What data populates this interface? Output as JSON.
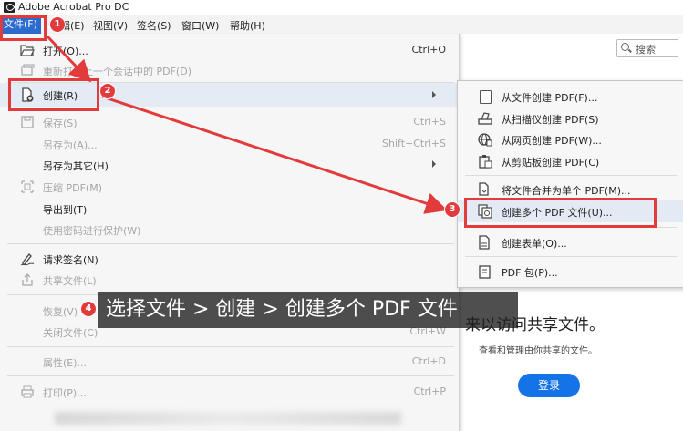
{
  "app": {
    "title": "Adobe Acrobat Pro DC"
  },
  "menubar": {
    "items": [
      "文件(F)",
      "编辑(E)",
      "视图(V)",
      "签名(S)",
      "窗口(W)",
      "帮助(H)"
    ]
  },
  "file_menu": {
    "items": [
      {
        "label": "打开(O)...",
        "shortcut": "Ctrl+O"
      },
      {
        "label": "重新打开上一个会话中的 PDF(D)"
      },
      {
        "label": "创建(R)"
      },
      {
        "label": "保存(S)",
        "shortcut": "Ctrl+S"
      },
      {
        "label": "另存为(A)...",
        "shortcut": "Shift+Ctrl+S"
      },
      {
        "label": "另存为其它(H)"
      },
      {
        "label": "压缩 PDF(M)"
      },
      {
        "label": "导出到(T)"
      },
      {
        "label": "使用密码进行保护(W)"
      },
      {
        "label": "请求签名(N)"
      },
      {
        "label": "共享文件(L)"
      },
      {
        "label": "恢复(V)"
      },
      {
        "label": "关闭文件(C)",
        "shortcut": "Ctrl+W"
      },
      {
        "label": "属性(E)...",
        "shortcut": "Ctrl+D"
      },
      {
        "label": "打印(P)...",
        "shortcut": "Ctrl+P"
      }
    ]
  },
  "create_submenu": {
    "items": [
      {
        "label": "从文件创建 PDF(F)..."
      },
      {
        "label": "从扫描仪创建 PDF(S)"
      },
      {
        "label": "从网页创建 PDF(W)..."
      },
      {
        "label": "从剪贴板创建 PDF(C)"
      },
      {
        "label": "将文件合并为单个 PDF(M)..."
      },
      {
        "label": "创建多个 PDF 文件(U)..."
      },
      {
        "label": "创建表单(O)..."
      },
      {
        "label": "PDF 包(P)..."
      }
    ]
  },
  "right_panel": {
    "search_placeholder": "搜索",
    "share_title": "来以访问共享文件。",
    "share_desc": "查看和管理由你共享的文件。",
    "login_label": "登录"
  },
  "annotations": {
    "badges": [
      "1",
      "2",
      "3",
      "4"
    ],
    "caption": "选择文件 > 创建 > 创建多个 PDF 文件"
  },
  "colors": {
    "highlight_red": "#e23b3b",
    "menu_active_blue": "#2b6bd0",
    "login_blue": "#1473e6"
  }
}
